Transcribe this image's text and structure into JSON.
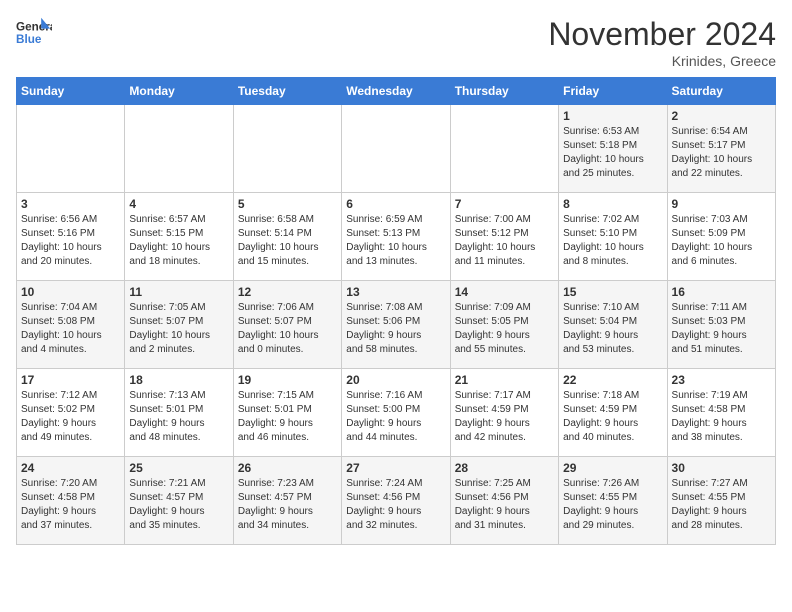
{
  "logo": {
    "line1": "General",
    "line2": "Blue"
  },
  "title": "November 2024",
  "subtitle": "Krinides, Greece",
  "days_header": [
    "Sunday",
    "Monday",
    "Tuesday",
    "Wednesday",
    "Thursday",
    "Friday",
    "Saturday"
  ],
  "weeks": [
    [
      {
        "day": "",
        "info": ""
      },
      {
        "day": "",
        "info": ""
      },
      {
        "day": "",
        "info": ""
      },
      {
        "day": "",
        "info": ""
      },
      {
        "day": "",
        "info": ""
      },
      {
        "day": "1",
        "info": "Sunrise: 6:53 AM\nSunset: 5:18 PM\nDaylight: 10 hours\nand 25 minutes."
      },
      {
        "day": "2",
        "info": "Sunrise: 6:54 AM\nSunset: 5:17 PM\nDaylight: 10 hours\nand 22 minutes."
      }
    ],
    [
      {
        "day": "3",
        "info": "Sunrise: 6:56 AM\nSunset: 5:16 PM\nDaylight: 10 hours\nand 20 minutes."
      },
      {
        "day": "4",
        "info": "Sunrise: 6:57 AM\nSunset: 5:15 PM\nDaylight: 10 hours\nand 18 minutes."
      },
      {
        "day": "5",
        "info": "Sunrise: 6:58 AM\nSunset: 5:14 PM\nDaylight: 10 hours\nand 15 minutes."
      },
      {
        "day": "6",
        "info": "Sunrise: 6:59 AM\nSunset: 5:13 PM\nDaylight: 10 hours\nand 13 minutes."
      },
      {
        "day": "7",
        "info": "Sunrise: 7:00 AM\nSunset: 5:12 PM\nDaylight: 10 hours\nand 11 minutes."
      },
      {
        "day": "8",
        "info": "Sunrise: 7:02 AM\nSunset: 5:10 PM\nDaylight: 10 hours\nand 8 minutes."
      },
      {
        "day": "9",
        "info": "Sunrise: 7:03 AM\nSunset: 5:09 PM\nDaylight: 10 hours\nand 6 minutes."
      }
    ],
    [
      {
        "day": "10",
        "info": "Sunrise: 7:04 AM\nSunset: 5:08 PM\nDaylight: 10 hours\nand 4 minutes."
      },
      {
        "day": "11",
        "info": "Sunrise: 7:05 AM\nSunset: 5:07 PM\nDaylight: 10 hours\nand 2 minutes."
      },
      {
        "day": "12",
        "info": "Sunrise: 7:06 AM\nSunset: 5:07 PM\nDaylight: 10 hours\nand 0 minutes."
      },
      {
        "day": "13",
        "info": "Sunrise: 7:08 AM\nSunset: 5:06 PM\nDaylight: 9 hours\nand 58 minutes."
      },
      {
        "day": "14",
        "info": "Sunrise: 7:09 AM\nSunset: 5:05 PM\nDaylight: 9 hours\nand 55 minutes."
      },
      {
        "day": "15",
        "info": "Sunrise: 7:10 AM\nSunset: 5:04 PM\nDaylight: 9 hours\nand 53 minutes."
      },
      {
        "day": "16",
        "info": "Sunrise: 7:11 AM\nSunset: 5:03 PM\nDaylight: 9 hours\nand 51 minutes."
      }
    ],
    [
      {
        "day": "17",
        "info": "Sunrise: 7:12 AM\nSunset: 5:02 PM\nDaylight: 9 hours\nand 49 minutes."
      },
      {
        "day": "18",
        "info": "Sunrise: 7:13 AM\nSunset: 5:01 PM\nDaylight: 9 hours\nand 48 minutes."
      },
      {
        "day": "19",
        "info": "Sunrise: 7:15 AM\nSunset: 5:01 PM\nDaylight: 9 hours\nand 46 minutes."
      },
      {
        "day": "20",
        "info": "Sunrise: 7:16 AM\nSunset: 5:00 PM\nDaylight: 9 hours\nand 44 minutes."
      },
      {
        "day": "21",
        "info": "Sunrise: 7:17 AM\nSunset: 4:59 PM\nDaylight: 9 hours\nand 42 minutes."
      },
      {
        "day": "22",
        "info": "Sunrise: 7:18 AM\nSunset: 4:59 PM\nDaylight: 9 hours\nand 40 minutes."
      },
      {
        "day": "23",
        "info": "Sunrise: 7:19 AM\nSunset: 4:58 PM\nDaylight: 9 hours\nand 38 minutes."
      }
    ],
    [
      {
        "day": "24",
        "info": "Sunrise: 7:20 AM\nSunset: 4:58 PM\nDaylight: 9 hours\nand 37 minutes."
      },
      {
        "day": "25",
        "info": "Sunrise: 7:21 AM\nSunset: 4:57 PM\nDaylight: 9 hours\nand 35 minutes."
      },
      {
        "day": "26",
        "info": "Sunrise: 7:23 AM\nSunset: 4:57 PM\nDaylight: 9 hours\nand 34 minutes."
      },
      {
        "day": "27",
        "info": "Sunrise: 7:24 AM\nSunset: 4:56 PM\nDaylight: 9 hours\nand 32 minutes."
      },
      {
        "day": "28",
        "info": "Sunrise: 7:25 AM\nSunset: 4:56 PM\nDaylight: 9 hours\nand 31 minutes."
      },
      {
        "day": "29",
        "info": "Sunrise: 7:26 AM\nSunset: 4:55 PM\nDaylight: 9 hours\nand 29 minutes."
      },
      {
        "day": "30",
        "info": "Sunrise: 7:27 AM\nSunset: 4:55 PM\nDaylight: 9 hours\nand 28 minutes."
      }
    ]
  ]
}
